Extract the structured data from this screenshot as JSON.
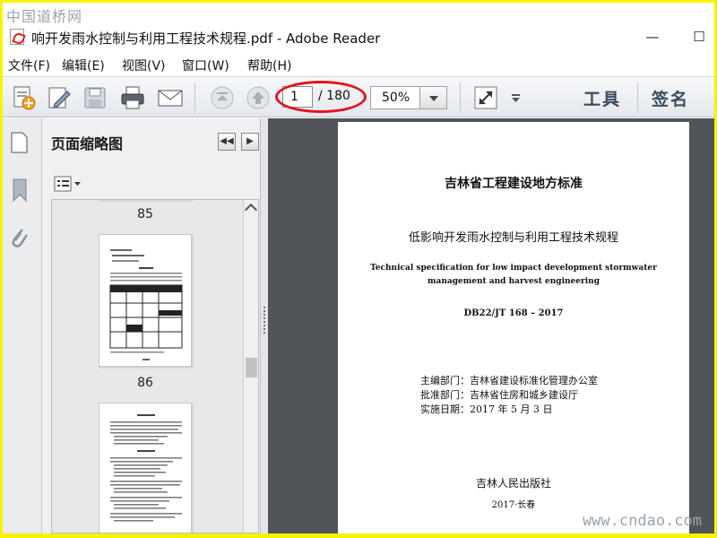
{
  "watermarks": {
    "top": "中国道桥网",
    "bottom": "www.cndao.com"
  },
  "window": {
    "title": "响开发雨水控制与利用工程技术规程.pdf - Adobe Reader",
    "minimize": "—",
    "maximize": "☐"
  },
  "menu": [
    {
      "label": "文件(F)"
    },
    {
      "label": "编辑(E)"
    },
    {
      "label": "视图(V)"
    },
    {
      "label": "窗口(W)"
    },
    {
      "label": "帮助(H)"
    }
  ],
  "toolbar": {
    "current_page": "1",
    "total_pages": "/ 180",
    "zoom": "50%",
    "tools_label": "工具",
    "sign_label": "签名",
    "highlight_color": "#e0141c"
  },
  "panel": {
    "title": "页面缩略图",
    "prev": "◀◀",
    "next": "▶",
    "thumbnails": [
      {
        "page": "85"
      },
      {
        "page": "86"
      }
    ]
  },
  "document": {
    "standard_title": "吉林省工程建设地方标准",
    "cn_title": "低影响开发雨水控制与利用工程技术规程",
    "en_title_line1": "Technical specification for low impact development stormwater",
    "en_title_line2": "management and harvest engineering",
    "code": "DB22/JT 168 – 2017",
    "editor": "主编部门：吉林省建设标准化管理办公室",
    "approver": "批准部门：吉林省住房和城乡建设厅",
    "effective": "实施日期：2017 年 5 月 3 日",
    "publisher": "吉林人民出版社",
    "city_year": "2017·长春"
  }
}
